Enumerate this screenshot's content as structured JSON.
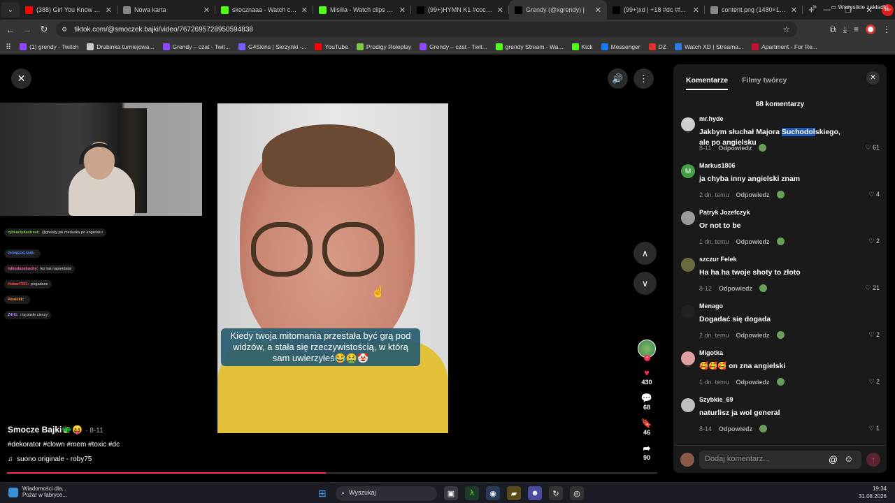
{
  "browser": {
    "tabs": [
      {
        "title": "(388) Girl You Know Its Tr...",
        "color": "#ff0000",
        "active": false
      },
      {
        "title": "Nowa karta",
        "color": "#888888",
        "active": false
      },
      {
        "title": "skocznaaa - Watch clips o...",
        "color": "#53fc18",
        "active": false
      },
      {
        "title": "Misilia - Watch clips on Ki...",
        "color": "#53fc18",
        "active": false
      },
      {
        "title": "(99+)HYMN K1 #cocorp #...",
        "color": "#000000",
        "active": false
      },
      {
        "title": "Grendy (@xgrendy) |",
        "color": "#000000",
        "active": true
      },
      {
        "title": "(99+)xd | +18 #dc #fyp #...",
        "color": "#000000",
        "active": false
      },
      {
        "title": "content.png (1480×1063)",
        "color": "#888888",
        "active": false
      }
    ],
    "tab_list_icon": "chevron-down",
    "new_tab_label": "+",
    "url": "tiktok.com/@smoczek.bajki/video/7672695728950594838",
    "profile_badge": "18+",
    "bookmarks": [
      {
        "label": "(1) grendy - Twitch",
        "color": "#9146ff"
      },
      {
        "label": "Drabinka turniejowa...",
        "color": "#cccccc"
      },
      {
        "label": "Grendy – czat - Twit...",
        "color": "#9146ff"
      },
      {
        "label": "G4Skins | Skrzynki -...",
        "color": "#7a5cff"
      },
      {
        "label": "YouTube",
        "color": "#ff0000"
      },
      {
        "label": "Prodigy Roleplay",
        "color": "#7ac943"
      },
      {
        "label": "Grendy – czat - Twit...",
        "color": "#9146ff"
      },
      {
        "label": "grendy Stream - Wa...",
        "color": "#53fc18"
      },
      {
        "label": "Kick",
        "color": "#53fc18"
      },
      {
        "label": "Messenger",
        "color": "#1877f2"
      },
      {
        "label": "DZ",
        "color": "#e03030"
      },
      {
        "label": "Watch XD | Streama...",
        "color": "#2b7de9"
      },
      {
        "label": "Apartment - For Re...",
        "color": "#c8102e"
      }
    ],
    "bookmarks_folder": "Wszystkie zakładki"
  },
  "stream_chat": [
    {
      "user": "rybkacipkastreet:",
      "text": "@grendy jak meduska po angielsku",
      "color": "#7ec850"
    },
    {
      "user": "PIONERGSNB:",
      "text": "",
      "color": "#5b8cff"
    },
    {
      "user": "tylkoduzebuchy:",
      "text": "tez tak napierdalal",
      "color": "#ff6bb5"
    },
    {
      "user": "HobarT551:",
      "text": "pogadano",
      "color": "#ff4f4f"
    },
    {
      "user": "Pawlekk:",
      "text": "",
      "color": "#ff8a3d"
    },
    {
      "user": "Z4H1:",
      "text": "i tą pizde cieszy",
      "color": "#b07cff"
    }
  ],
  "video": {
    "caption": "Kiedy twoja mitomania przestała być grą pod widzów, a stała się rzeczywistością, w którą sam uwierzyłeś😂🤮🤡",
    "author": "Smocze Bajki🐲😝",
    "date": "· 8-11",
    "hashtags": "#dekorator #clown #mem #toxic #dc",
    "music": "suono originale - roby75",
    "progress": 0.49,
    "likes": "430",
    "comments": "68",
    "saves": "46",
    "shares": "90"
  },
  "panel": {
    "tab_comments": "Komentarze",
    "tab_creator_videos": "Filmy twórcy",
    "count_label": "68 komentarzy",
    "reply_label": "Odpowiedz",
    "input_placeholder": "Dodaj komentarz...",
    "comments": [
      {
        "user": "mr.hyde",
        "text_before": "Jakbym słuchał Majora ",
        "text_highlight": "Suchodol",
        "text_after": "skiego, ale po angielsku",
        "date": "8-11",
        "likes": "61",
        "avatar_color": "#cfcfcf"
      },
      {
        "user": "Markus1806",
        "text_before": "ja chyba inny angielski znam",
        "text_highlight": "",
        "text_after": "",
        "date": "2 dn. temu",
        "likes": "4",
        "avatar_color": "#43a047",
        "avatar_letter": "M"
      },
      {
        "user": "Patryk Jozefczyk",
        "text_before": "Or not to be",
        "text_highlight": "",
        "text_after": "",
        "date": "1 dn. temu",
        "likes": "2",
        "avatar_color": "#9a9a9a"
      },
      {
        "user": "szczur Felek",
        "text_before": "Ha ha ha twoje shoty to złoto",
        "text_highlight": "",
        "text_after": "",
        "date": "8-12",
        "likes": "21",
        "avatar_color": "#6a6a40"
      },
      {
        "user": "Menago",
        "text_before": "Dogadać się dogada",
        "text_highlight": "",
        "text_after": "",
        "date": "2 dn. temu",
        "likes": "2",
        "avatar_color": "#222222"
      },
      {
        "user": "Migotka",
        "text_before": "🥰🥰🥰 on zna angielski",
        "text_highlight": "",
        "text_after": "",
        "date": "1 dn. temu",
        "likes": "2",
        "avatar_color": "#e0a0a0"
      },
      {
        "user": "Szybkie_69",
        "text_before": "naturlisz ja wol general",
        "text_highlight": "",
        "text_after": "",
        "date": "8-14",
        "likes": "1",
        "avatar_color": "#bfbfbf"
      }
    ]
  },
  "taskbar": {
    "weather_title": "Wiadomości dla...",
    "weather_sub": "Pożar w fabryce...",
    "search_label": "Wyszukaj",
    "time": "19:34",
    "date": "31.08.2026"
  }
}
